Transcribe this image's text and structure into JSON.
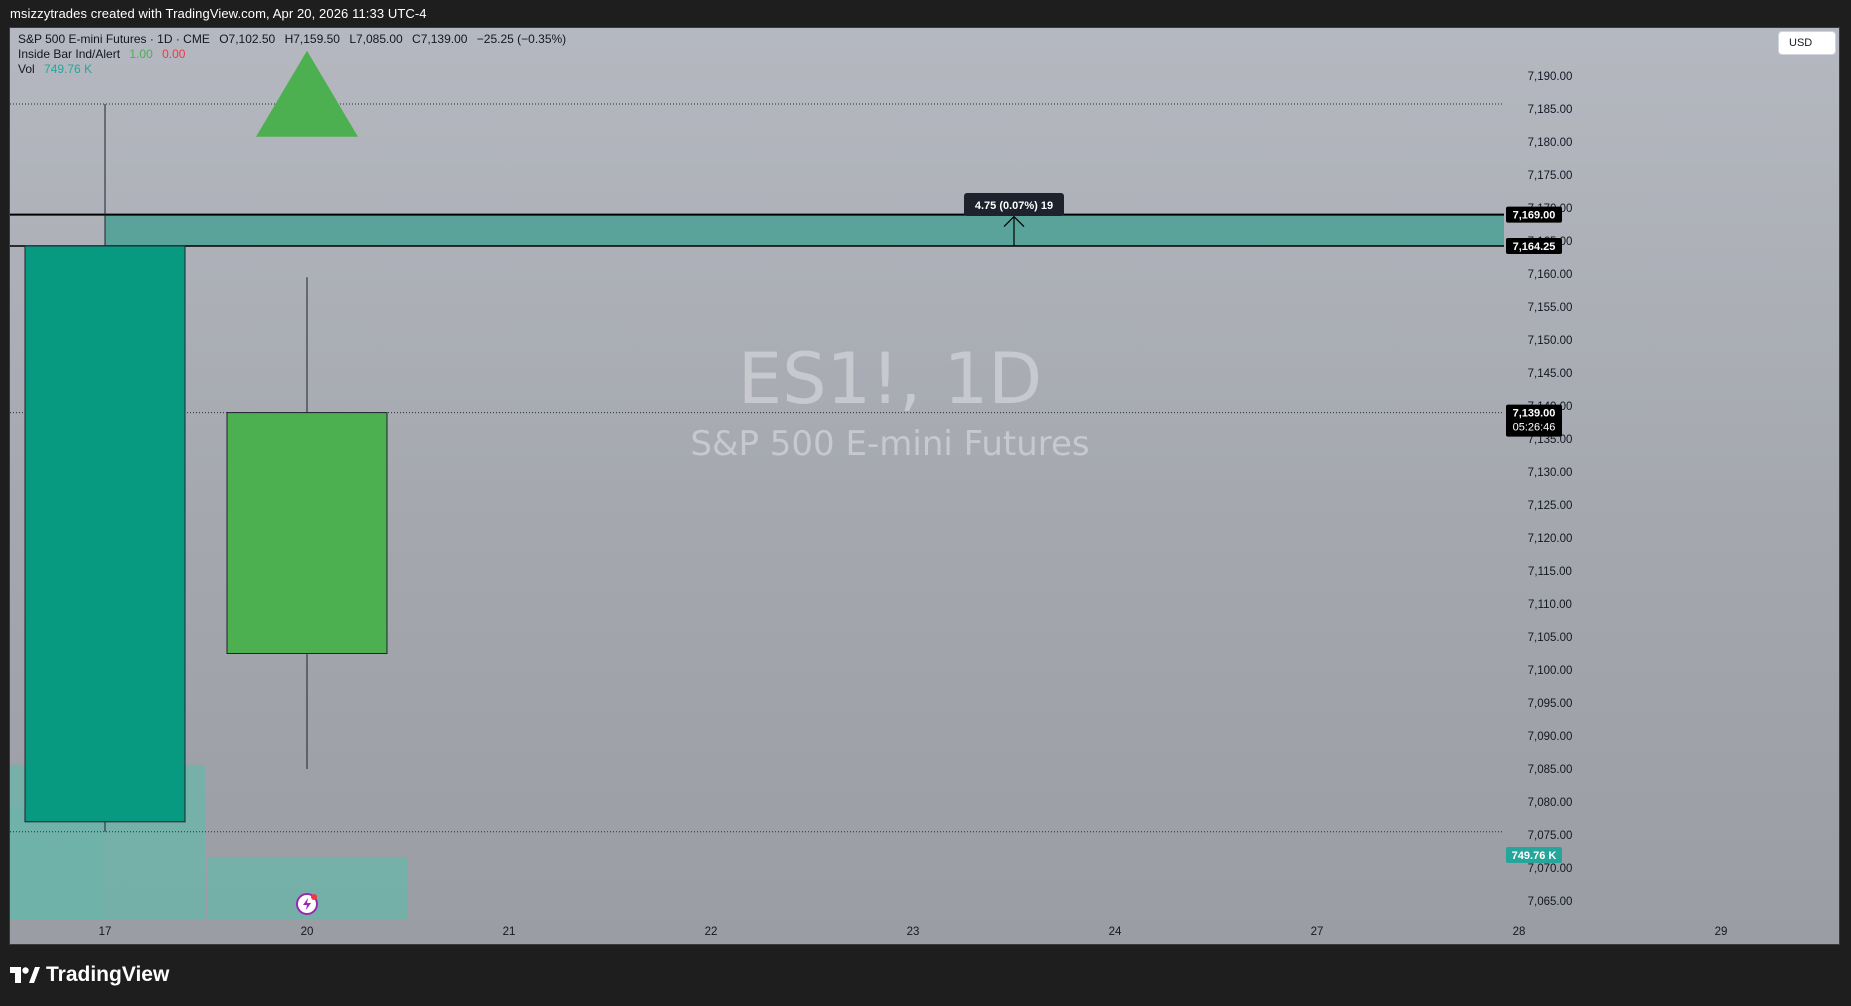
{
  "header": {
    "byline": "msizzytrades created with TradingView.com, Apr 20, 2026 11:33 UTC-4"
  },
  "legend": {
    "symbol_line": "S&P 500 E-mini Futures · 1D · CME",
    "open": "O7,102.50",
    "high": "H7,159.50",
    "low": "L7,085.00",
    "close": "C7,139.00",
    "change": "−25.25 (−0.35%)",
    "indicator_name": "Inside Bar Ind/Alert",
    "indicator_val1": "1.00",
    "indicator_val2": "0.00",
    "vol_label": "Vol",
    "vol_value": "749.76 K"
  },
  "currency_button": "USD",
  "watermark": {
    "symbol": "ES1!, 1D",
    "description": "S&P 500 E-mini Futures"
  },
  "measure_tooltip": "4.75 (0.07%) 19",
  "price_tags": {
    "upper": "7,169.00",
    "lower": "7,164.25",
    "last": "7,139.00",
    "countdown": "05:26:46",
    "volume": "749.76 K"
  },
  "footer": {
    "brand": "TradingView"
  },
  "colors": {
    "up": "#4caf50",
    "down": "#089981",
    "zone": "#5aa39a",
    "volume": "#6fb3a9",
    "signal": "#4caf50"
  },
  "chart_data": {
    "type": "candlestick",
    "title": "ES1!, 1D",
    "subtitle": "S&P 500 E-mini Futures",
    "ylim": [
      7062,
      7196
    ],
    "y_ticks": [
      7065,
      7070,
      7075,
      7080,
      7085,
      7090,
      7095,
      7100,
      7105,
      7110,
      7115,
      7120,
      7125,
      7130,
      7135,
      7140,
      7145,
      7150,
      7155,
      7160,
      7165,
      7170,
      7175,
      7180,
      7185,
      7190
    ],
    "x_ticks": [
      "17",
      "20",
      "21",
      "22",
      "23",
      "24",
      "27",
      "28",
      "29"
    ],
    "candles": [
      {
        "date": "17",
        "open": 7164.25,
        "high": 7185.75,
        "low": 7075.5,
        "close": 7077.0,
        "direction": "down"
      },
      {
        "date": "20",
        "open": 7102.5,
        "high": 7159.5,
        "low": 7085.0,
        "close": 7139.0,
        "direction": "up"
      }
    ],
    "volume_bars": [
      {
        "date": "16",
        "relative": 0.24
      },
      {
        "date": "17",
        "relative": 0.335
      },
      {
        "date": "20",
        "relative": 0.135
      }
    ],
    "zone": {
      "from_date": "17",
      "to_date": "29",
      "upper": 7169.0,
      "lower": 7164.25
    },
    "horizontal_lines": [
      7185.75,
      7139.0,
      7075.5
    ],
    "signal": {
      "date": "20",
      "price": 7187.0,
      "shape": "triangle-up"
    },
    "measurement": {
      "date_index": 4.5,
      "from": 7164.25,
      "to": 7169.0
    }
  }
}
